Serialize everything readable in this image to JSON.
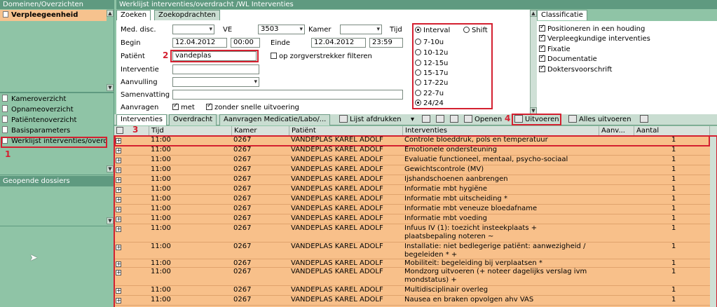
{
  "sidebar": {
    "domains_header": "Domeinen/Overzichten",
    "domain_active": "Verpleegeenheid",
    "nav_items": [
      "Kameroverzicht",
      "Opnameoverzicht",
      "Patiëntenoverzicht",
      "Basisparameters",
      "Werklijst interventies/overdracht"
    ],
    "open_files_header": "Geopende dossiers"
  },
  "window": {
    "title": "Werklijst interventies/overdracht /WL Interventies"
  },
  "filter_tabs": [
    "Zoeken",
    "Zoekopdrachten"
  ],
  "filters": {
    "med_disc_label": "Med. disc.",
    "med_disc_value": "",
    "ve_label": "VE",
    "ve_value": "3503",
    "kamer_label": "Kamer",
    "kamer_value": "",
    "tijd_label": "Tijd",
    "begin_label": "Begin",
    "begin_date": "12.04.2012",
    "begin_time": "00:00",
    "einde_label": "Einde",
    "einde_date": "12.04.2012",
    "einde_time": "23:59",
    "patient_label": "Patiënt",
    "patient_value": "vandeplas",
    "zorgverstrekker_label": "op zorgverstrekker filteren",
    "interventie_label": "Interventie",
    "aanvulling_label": "Aanvulling",
    "samenvatting_label": "Samenvatting",
    "aanvragen_label": "Aanvragen",
    "met_label": "met",
    "zonder_label": "zonder snelle uitvoering"
  },
  "time_options": {
    "interval": "Interval",
    "shift": "Shift",
    "slots": [
      "7-10u",
      "10-12u",
      "12-15u",
      "15-17u",
      "17-22u",
      "22-7u",
      "24/24"
    ]
  },
  "classificatie": {
    "tab": "Classificatie",
    "items": [
      "Positioneren in een houding",
      "Verpleegkundige interventies",
      "Fixatie",
      "Documentatie",
      "Doktersvoorschrift"
    ]
  },
  "result_tabs": [
    "Interventies",
    "Overdracht",
    "Aanvragen Medicatie/Labo/..."
  ],
  "toolbar": {
    "print": "Lijst afdrukken",
    "open": "Openen",
    "execute": "Uitvoeren",
    "execute_all": "Alles uitvoeren"
  },
  "columns": [
    "Tijd",
    "Kamer",
    "Patiënt",
    "Interventies",
    "Aanv...",
    "Aantal"
  ],
  "rows": [
    [
      "11:00",
      "0267",
      "VANDEPLAS KAREL ADOLF",
      "Controle bloeddruk, pols en temperatuur",
      "1"
    ],
    [
      "11:00",
      "0267",
      "VANDEPLAS KAREL ADOLF",
      "Emotionele ondersteuning",
      "1"
    ],
    [
      "11:00",
      "0267",
      "VANDEPLAS KAREL ADOLF",
      "Evaluatie functioneel, mentaal, psycho-sociaal",
      "1"
    ],
    [
      "11:00",
      "0267",
      "VANDEPLAS KAREL ADOLF",
      "Gewichtscontrole (MV)",
      "1"
    ],
    [
      "11:00",
      "0267",
      "VANDEPLAS KAREL ADOLF",
      "Ijshandschoenen aanbrengen",
      "1"
    ],
    [
      "11:00",
      "0267",
      "VANDEPLAS KAREL ADOLF",
      "Informatie mbt hygiëne",
      "1"
    ],
    [
      "11:00",
      "0267",
      "VANDEPLAS KAREL ADOLF",
      "Informatie mbt uitscheiding *",
      "1"
    ],
    [
      "11:00",
      "0267",
      "VANDEPLAS KAREL ADOLF",
      "Informatie mbt veneuze bloedafname",
      "1"
    ],
    [
      "11:00",
      "0267",
      "VANDEPLAS KAREL ADOLF",
      "Informatie mbt voeding",
      "1"
    ],
    [
      "11:00",
      "0267",
      "VANDEPLAS KAREL ADOLF",
      "Infuus IV (1): toezicht insteekplaats + plaatsbepaling noteren ~",
      "1"
    ],
    [
      "11:00",
      "0267",
      "VANDEPLAS KAREL ADOLF",
      "Installatie: niet bedlegerige patiënt: aanwezigheid / begeleiden * +",
      "1"
    ],
    [
      "11:00",
      "0267",
      "VANDEPLAS KAREL ADOLF",
      "Mobiliteit: begeleiding bij verplaatsen *",
      "1"
    ],
    [
      "11:00",
      "0267",
      "VANDEPLAS KAREL ADOLF",
      "Mondzorg uitvoeren (+ noteer dagelijks verslag ivm mondstatus) +",
      "1"
    ],
    [
      "11:00",
      "0267",
      "VANDEPLAS KAREL ADOLF",
      "Multidisciplinair overleg",
      "1"
    ],
    [
      "11:00",
      "0267",
      "VANDEPLAS KAREL ADOLF",
      "Nausea en braken opvolgen ahv VAS",
      "1"
    ]
  ],
  "markers": [
    "1",
    "2",
    "3",
    "4"
  ]
}
